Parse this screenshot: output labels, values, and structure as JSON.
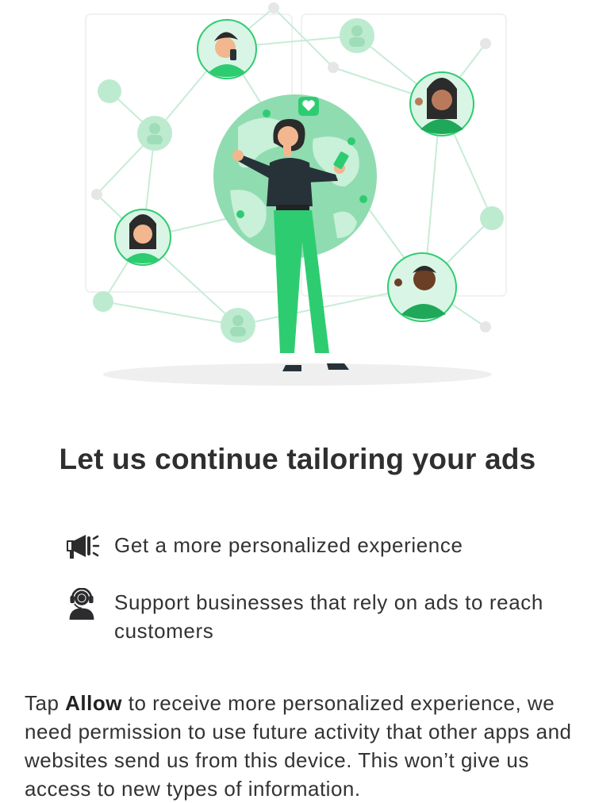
{
  "title": "Let us continue tailoring your ads",
  "benefits": [
    {
      "icon": "megaphone-icon",
      "text": "Get a more personalized experience"
    },
    {
      "icon": "support-agent-icon",
      "text": "Support businesses that rely on ads to reach customers"
    }
  ],
  "body": {
    "prefix": "Tap ",
    "emphasis": "Allow",
    "rest": " to receive more personalized experience, we need permission to use future activity that other apps and websites send us from this device. This won’t give us access to new types of information."
  },
  "colors": {
    "accent": "#2ecc71",
    "accent_dark": "#1fa85a",
    "light_green": "#a8e6c1",
    "text": "#333333"
  }
}
